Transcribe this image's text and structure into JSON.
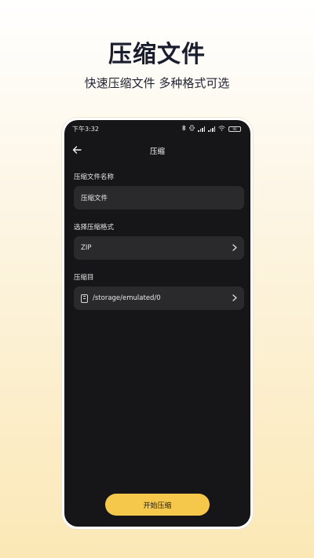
{
  "promo": {
    "title": "压缩文件",
    "subtitle": "快速压缩文件  多种格式可选"
  },
  "status_bar": {
    "time": "下午3:32",
    "battery": "90"
  },
  "navbar": {
    "title": "压缩",
    "back_icon": "arrow-left-icon"
  },
  "form": {
    "filename_label": "压缩文件名称",
    "filename_value": "压缩文件",
    "format_label": "选择压缩格式",
    "format_value": "ZIP",
    "dir_label": "压缩目",
    "dir_value": "/storage/emulated/0"
  },
  "action": {
    "start_label": "开始压缩"
  },
  "colors": {
    "accent": "#f5c84c",
    "screen_bg": "#161618",
    "field_bg": "#2a2a2c"
  }
}
